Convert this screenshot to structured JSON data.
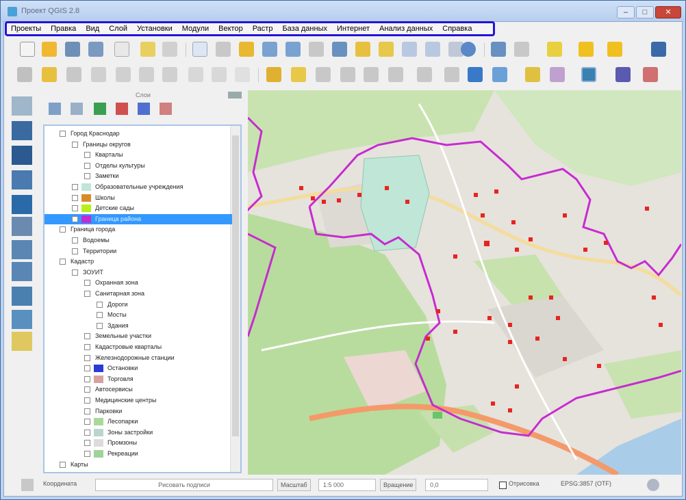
{
  "window": {
    "title": "Проект QGIS 2.8",
    "min_glyph": "–",
    "max_glyph": "□",
    "close_glyph": "✕"
  },
  "menu": [
    "Проекты",
    "Правка",
    "Вид",
    "Слой",
    "Установки",
    "Модули",
    "Вектор",
    "Растр",
    "База данных",
    "Интернет",
    "Анализ данных",
    "Справка"
  ],
  "layers_panel": {
    "title": "Слои",
    "rows": [
      {
        "label": "Город Краснодар",
        "indent": 0,
        "kind": "group"
      },
      {
        "label": "Границы округов",
        "indent": 1,
        "kind": "group"
      },
      {
        "label": "Кварталы",
        "indent": 2,
        "kind": "check"
      },
      {
        "label": "Отделы культуры",
        "indent": 2,
        "kind": "text"
      },
      {
        "label": "Заметки",
        "indent": 2,
        "kind": "text"
      },
      {
        "label": "Образовательные учреждения",
        "indent": 1,
        "kind": "swatch",
        "color": "#bfe6d6"
      },
      {
        "label": "Школы",
        "indent": 1,
        "kind": "swatch",
        "color": "#d88b2a"
      },
      {
        "label": "Детские сады",
        "indent": 1,
        "kind": "swatch",
        "color": "#b6f01a"
      },
      {
        "label": "Граница района",
        "indent": 1,
        "kind": "swatch",
        "color": "#c62bd0",
        "selected": true
      },
      {
        "label": "Граница города",
        "indent": 0,
        "kind": "group"
      },
      {
        "label": "Водоемы",
        "indent": 1,
        "kind": "check"
      },
      {
        "label": "Территории",
        "indent": 1,
        "kind": "text"
      },
      {
        "label": "Кадастр",
        "indent": 0,
        "kind": "group"
      },
      {
        "label": "ЗОУИТ",
        "indent": 1,
        "kind": "group"
      },
      {
        "label": "Охранная зона",
        "indent": 2,
        "kind": "text"
      },
      {
        "label": "Санитарная зона",
        "indent": 2,
        "kind": "text"
      },
      {
        "label": "Дороги",
        "indent": 3,
        "kind": "text"
      },
      {
        "label": "Мосты",
        "indent": 3,
        "kind": "text"
      },
      {
        "label": "Здания",
        "indent": 3,
        "kind": "text"
      },
      {
        "label": "Земельные участки",
        "indent": 2,
        "kind": "text"
      },
      {
        "label": "Кадастровые кварталы",
        "indent": 2,
        "kind": "text"
      },
      {
        "label": "Железнодорожные станции",
        "indent": 2,
        "kind": "text"
      },
      {
        "label": "Остановки",
        "indent": 2,
        "kind": "swatch",
        "color": "#2b3bd8"
      },
      {
        "label": "Торговля",
        "indent": 2,
        "kind": "swatch",
        "color": "#d8a0a0"
      },
      {
        "label": "Автосервисы",
        "indent": 2,
        "kind": "text"
      },
      {
        "label": "Медицинские центры",
        "indent": 2,
        "kind": "text"
      },
      {
        "label": "Парковки",
        "indent": 2,
        "kind": "text"
      },
      {
        "label": "Лесопарки",
        "indent": 2,
        "kind": "swatch",
        "color": "#a9d89a"
      },
      {
        "label": "Зоны застройки",
        "indent": 2,
        "kind": "swatch",
        "color": "#b9d6cc"
      },
      {
        "label": "Промзоны",
        "indent": 2,
        "kind": "swatch",
        "color": "#dcdcdc"
      },
      {
        "label": "Рекреации",
        "indent": 2,
        "kind": "swatch",
        "color": "#9ed39a"
      },
      {
        "label": "Карты",
        "indent": 0,
        "kind": "group"
      }
    ]
  },
  "statusbar": {
    "coord_label": "Координата",
    "coord_value": "",
    "render_value": "Рисовать подписи",
    "scale_label": "Масштаб",
    "scale_value": "1:5 000",
    "rotation_label": "Вращение",
    "rotation_value": "0,0",
    "render_check_label": "Отрисовка",
    "crs_label": "EPSG:3857 (OTF)"
  },
  "colors": {
    "menu_highlight": "#2313d8",
    "district_boundary": "#c62bd0",
    "points": "#e8241e",
    "parks": "#b8dc9e",
    "road": "#f49a6a",
    "water": "#a9cce8"
  }
}
